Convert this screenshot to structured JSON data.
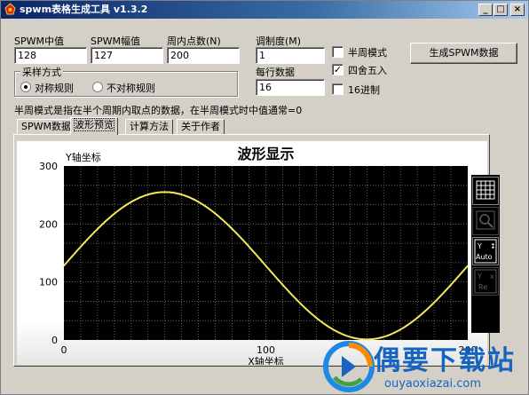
{
  "app": {
    "title": "spwm表格生成工具 v1.3.2",
    "titlebar_buttons": {
      "minimize": "_",
      "maximize": "□",
      "close": "×"
    }
  },
  "params": {
    "spwm_mid_label": "SPWM中值",
    "spwm_mid_value": "128",
    "spwm_amp_label": "SPWM幅值",
    "spwm_amp_value": "127",
    "points_label": "周内点数(N)",
    "points_value": "200",
    "modulation_label": "调制度(M)",
    "modulation_value": "1",
    "per_row_label": "每行数据",
    "per_row_value": "16"
  },
  "options": {
    "half_period": {
      "label": "半周模式",
      "checked": false
    },
    "rounding": {
      "label": "四舍五入",
      "checked": true
    },
    "hex": {
      "label": "16进制",
      "checked": false
    }
  },
  "generate_button": "生成SPWM数据",
  "sampling": {
    "title": "采样方式",
    "symmetric": {
      "label": "对称规则",
      "selected": true
    },
    "asymmetric": {
      "label": "不对称规则",
      "selected": false
    }
  },
  "hint": "半周模式是指在半个周期内取点的数据，在半周模式时中值通常=0",
  "tabs": [
    {
      "label": "SPWM数据",
      "active": false
    },
    {
      "label": "波形预览",
      "active": true
    },
    {
      "label": "计算方法",
      "active": false
    },
    {
      "label": "关于作者",
      "active": false
    }
  ],
  "toolbar": {
    "icons": [
      "grid-icon",
      "zoom-icon",
      "y-auto-icon",
      "y-reset-icon"
    ],
    "auto_label": "Auto",
    "reset_label": "Re"
  },
  "watermark": {
    "text": "偶要下载站",
    "url": "ouyaoxiazai.com"
  },
  "chart_data": {
    "type": "line",
    "title": "波形显示",
    "xlabel": "X轴坐标",
    "ylabel": "Y轴坐标",
    "xlim": [
      0,
      200
    ],
    "ylim": [
      0,
      300
    ],
    "xticks": [
      0,
      100,
      200
    ],
    "yticks": [
      0,
      100,
      200,
      300
    ],
    "grid": true,
    "background": "#000000",
    "series": [
      {
        "color": "#f5e65a",
        "mid": 128,
        "amplitude": 127,
        "period_points": 200,
        "x": [
          0,
          10,
          20,
          30,
          40,
          50,
          60,
          70,
          80,
          90,
          100,
          110,
          120,
          130,
          140,
          150,
          160,
          170,
          180,
          190,
          200
        ],
        "y": [
          128,
          167,
          203,
          231,
          249,
          255,
          249,
          231,
          203,
          167,
          128,
          89,
          53,
          25,
          7,
          1,
          7,
          25,
          53,
          89,
          128
        ]
      }
    ]
  }
}
